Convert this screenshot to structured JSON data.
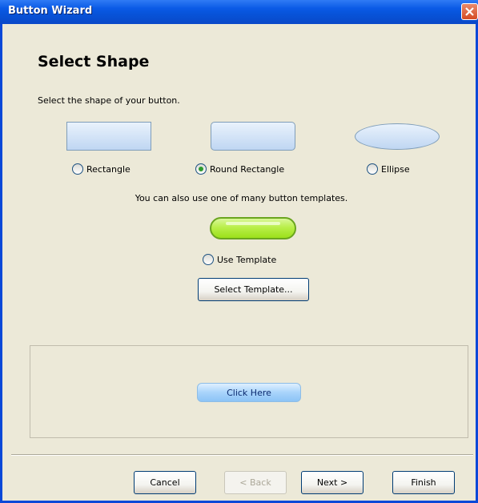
{
  "window": {
    "title": "Button Wizard",
    "close_icon": "close-icon"
  },
  "page": {
    "heading": "Select Shape",
    "subtext": "Select the shape of your button."
  },
  "shapes": {
    "rectangle_label": "Rectangle",
    "round_rectangle_label": "Round Rectangle",
    "ellipse_label": "Ellipse",
    "selected": "round_rectangle"
  },
  "templates": {
    "note": "You can also use one of many button templates.",
    "use_template_label": "Use Template",
    "select_template_button": "Select Template..."
  },
  "preview": {
    "button_label": "Click Here"
  },
  "footer": {
    "cancel": "Cancel",
    "back": "< Back",
    "next": "Next >",
    "finish": "Finish"
  },
  "colors": {
    "titlebar": "#0a5ae6",
    "dialog_bg": "#ece9d8",
    "template_green": "#9ce01a",
    "preview_button_blue": "#a9d4fb"
  }
}
